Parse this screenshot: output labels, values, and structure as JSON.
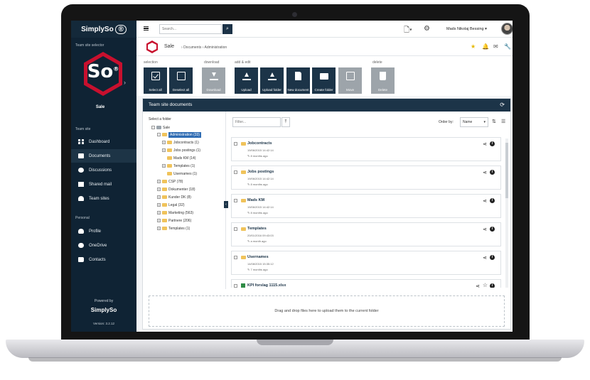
{
  "sidebar": {
    "brand": "SimplySo",
    "team_selector_label": "Team site selector",
    "logo_text": "So",
    "site_name": "Sale",
    "team_site_label": "Team site",
    "items": [
      {
        "label": "Dashboard",
        "icon": "dashboard-icon"
      },
      {
        "label": "Documents",
        "icon": "folder-icon"
      },
      {
        "label": "Discussions",
        "icon": "chat-icon"
      },
      {
        "label": "Shared mail",
        "icon": "mail-icon"
      },
      {
        "label": "Team sites",
        "icon": "team-sites-icon"
      }
    ],
    "personal_label": "Personal",
    "personal_items": [
      {
        "label": "Profile",
        "icon": "user-icon"
      },
      {
        "label": "OneDrive",
        "icon": "cloud-icon"
      },
      {
        "label": "Contacts",
        "icon": "contacts-icon"
      }
    ],
    "powered_by": "Powered by",
    "powered_logo": "SimplySo",
    "version": "Version: 3.2.12"
  },
  "topbar": {
    "search_placeholder": "Search...",
    "user_name": "Mads Nikolaj Bessing"
  },
  "breadcrumb": {
    "site": "Sale",
    "path": "Documents › Administration"
  },
  "toolbar": {
    "groups": {
      "selection": "selection",
      "download": "download",
      "add_edit": "add & edit",
      "delete": "delete"
    },
    "buttons": {
      "select_all": "Select all",
      "deselect_all": "Deselect all",
      "download": "Download",
      "upload": "Upload",
      "upload_folder": "Upload folder",
      "new_document": "New document",
      "create_folder": "Create folder",
      "move": "Move",
      "delete": "Delete"
    }
  },
  "panel": {
    "title": "Team site documents",
    "select_folder_label": "Select a folder",
    "tree": {
      "root": "Sale",
      "admin": "Administration (33)",
      "jobcontracts": "Jobcontracts (1)",
      "jobs_postings": "Jobs postings (1)",
      "mads_km": "Mads KM (14)",
      "templates_sub": "Templates (1)",
      "usernames": "Usernames (1)",
      "csp": "CSP (78)",
      "dokumenter": "Dokumenter (18)",
      "kunder": "Kunder DK (8)",
      "legal": "Legal (32)",
      "marketing": "Marketing (563)",
      "partnere": "Partnere (206)",
      "templates": "Templates (1)"
    },
    "filter_placeholder": "Filter...",
    "order_by_label": "Order by:",
    "order_by_value": "Name",
    "rows": [
      {
        "name": "Jobcontracts",
        "date": "19/06/2015 14:42:14",
        "age": "8 months ago"
      },
      {
        "name": "Jobs postings",
        "date": "19/06/2015 14:42:14",
        "age": "8 months ago"
      },
      {
        "name": "Mads KM",
        "date": "19/06/2015 14:42:14",
        "age": "8 months ago"
      },
      {
        "name": "Templates",
        "date": "20/01/2016 09:43:03",
        "age": "a month ago"
      },
      {
        "name": "Usernames",
        "date": "14/08/2015 15:35:12",
        "age": "7 months ago"
      },
      {
        "name": "KPI forslag 1115.xlsx",
        "date": "",
        "age": ""
      }
    ],
    "drop_text": "Drag and drop files here to upload them to the current folder"
  },
  "colors": {
    "sidebar_bg": "#0f2334",
    "accent": "#1c3448",
    "brand_red": "#c8102e",
    "selected_node": "#2f6cb3"
  }
}
